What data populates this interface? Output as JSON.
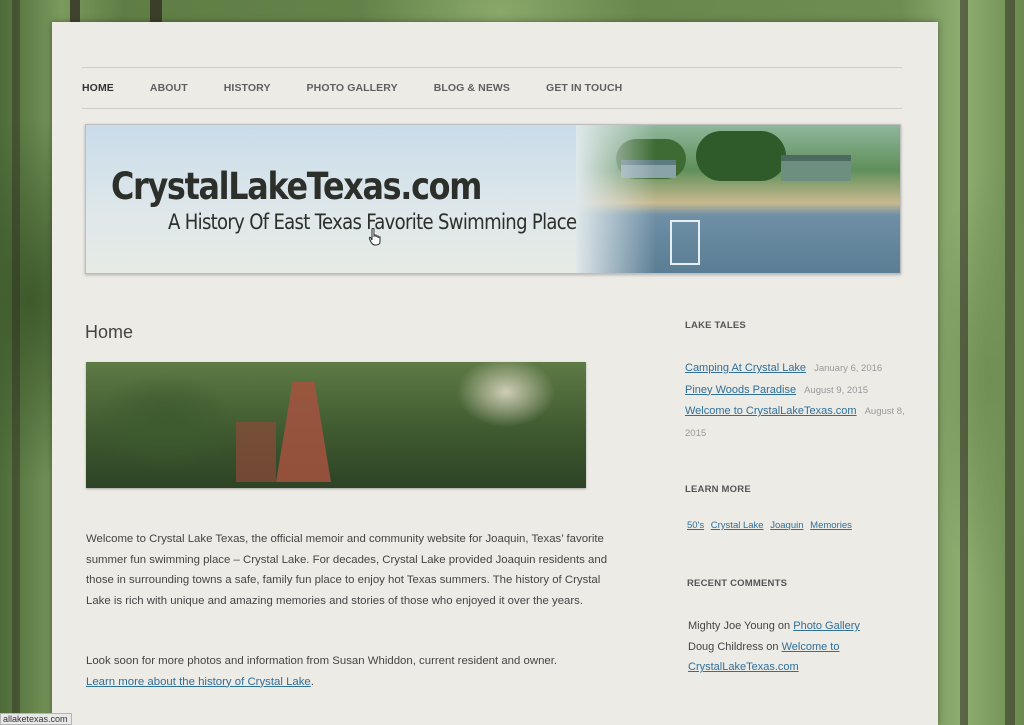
{
  "nav": {
    "items": [
      "HOME",
      "ABOUT",
      "HISTORY",
      "PHOTO GALLERY",
      "BLOG & NEWS",
      "GET IN TOUCH"
    ]
  },
  "header": {
    "title": "CrystalLakeTexas.com",
    "subtitle": "A History Of East Texas Favorite Swimming Place"
  },
  "main": {
    "title": "Home",
    "paragraph1": "Welcome to Crystal Lake Texas, the official memoir and community website for Joaquin, Texas’ favorite summer fun swimming place – Crystal Lake. For decades, Crystal Lake provided Joaquin residents and those in surrounding towns a safe, family fun place to enjoy hot Texas summers. The history of Crystal Lake is rich with unique and amazing memories and stories of those who enjoyed it over the years.",
    "paragraph2": "Look soon for more photos and information from Susan Whiddon, current resident and owner.",
    "learn_more_link": "Learn more about the history of Crystal Lake",
    "learn_more_after": "."
  },
  "sidebar": {
    "lake_tales": {
      "title": "LAKE TALES",
      "items": [
        {
          "label": "Camping At Crystal Lake",
          "date": "January 6, 2016"
        },
        {
          "label": "Piney Woods Paradise",
          "date": "August 9, 2015"
        },
        {
          "label": "Welcome to CrystalLakeTexas.com",
          "date": "August 8, 2015"
        }
      ]
    },
    "learn_more": {
      "title": "LEARN MORE",
      "tags": [
        "50's",
        "Crystal Lake",
        "Joaquin",
        "Memories"
      ]
    },
    "recent_comments": {
      "title": "RECENT COMMENTS",
      "items": [
        {
          "author": "Mighty Joe Young",
          "on": "on",
          "post": "Photo Gallery"
        },
        {
          "author": "Doug Childress",
          "on": "on",
          "post": "Welcome to CrystalLakeTexas.com"
        }
      ]
    }
  },
  "status_bar": {
    "url": "allaketexas.com"
  },
  "colors": {
    "link": "#2f6f9a",
    "page_bg": "#ecebe6"
  }
}
